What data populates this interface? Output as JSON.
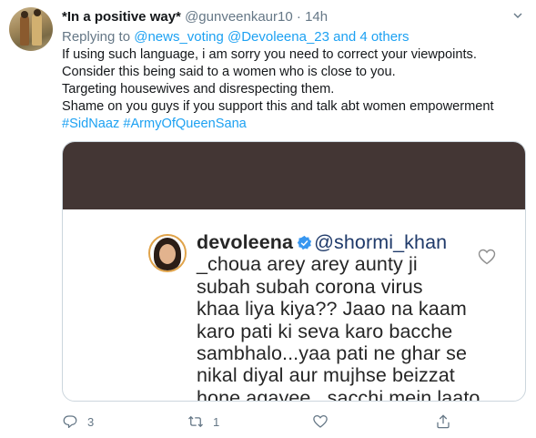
{
  "tweet": {
    "author_name": "*In a positive way*",
    "handle": "@gunveenkaur10",
    "separator": "·",
    "time": "14h",
    "replying_to_prefix": "Replying to",
    "replying_to_users": "@news_voting @Devoleena_23 and 4 others",
    "lines": [
      "If using such language, i am sorry you need to correct your viewpoints.",
      "Consider this being said to a women who is close to you.",
      "Targeting housewives and disrespecting them.",
      "Shame on you guys if you support this and talk abt women empowerment"
    ],
    "hashtags": "#SidNaaz #ArmyOfQueenSana",
    "embedded_image": {
      "username": "devoleena",
      "mention": "@shormi_khan",
      "comment_lines": [
        "_choua arey arey aunty ji",
        "subah subah corona virus",
        "khaa liya kiya?? Jaao na kaam",
        "karo pati ki seva karo bacche",
        "sambhalo...yaa pati ne ghar se",
        "nikal diyal aur mujhse beizzat",
        "hone agayee...sacchi mein laato"
      ],
      "dark_band_color": "#433634"
    },
    "actions": {
      "reply_count": "3",
      "retweet_count": "1",
      "like_count": "",
      "share_label": ""
    },
    "colors": {
      "link": "#1da1f2",
      "secondary_text": "#657786",
      "primary_text": "#14171a"
    }
  }
}
